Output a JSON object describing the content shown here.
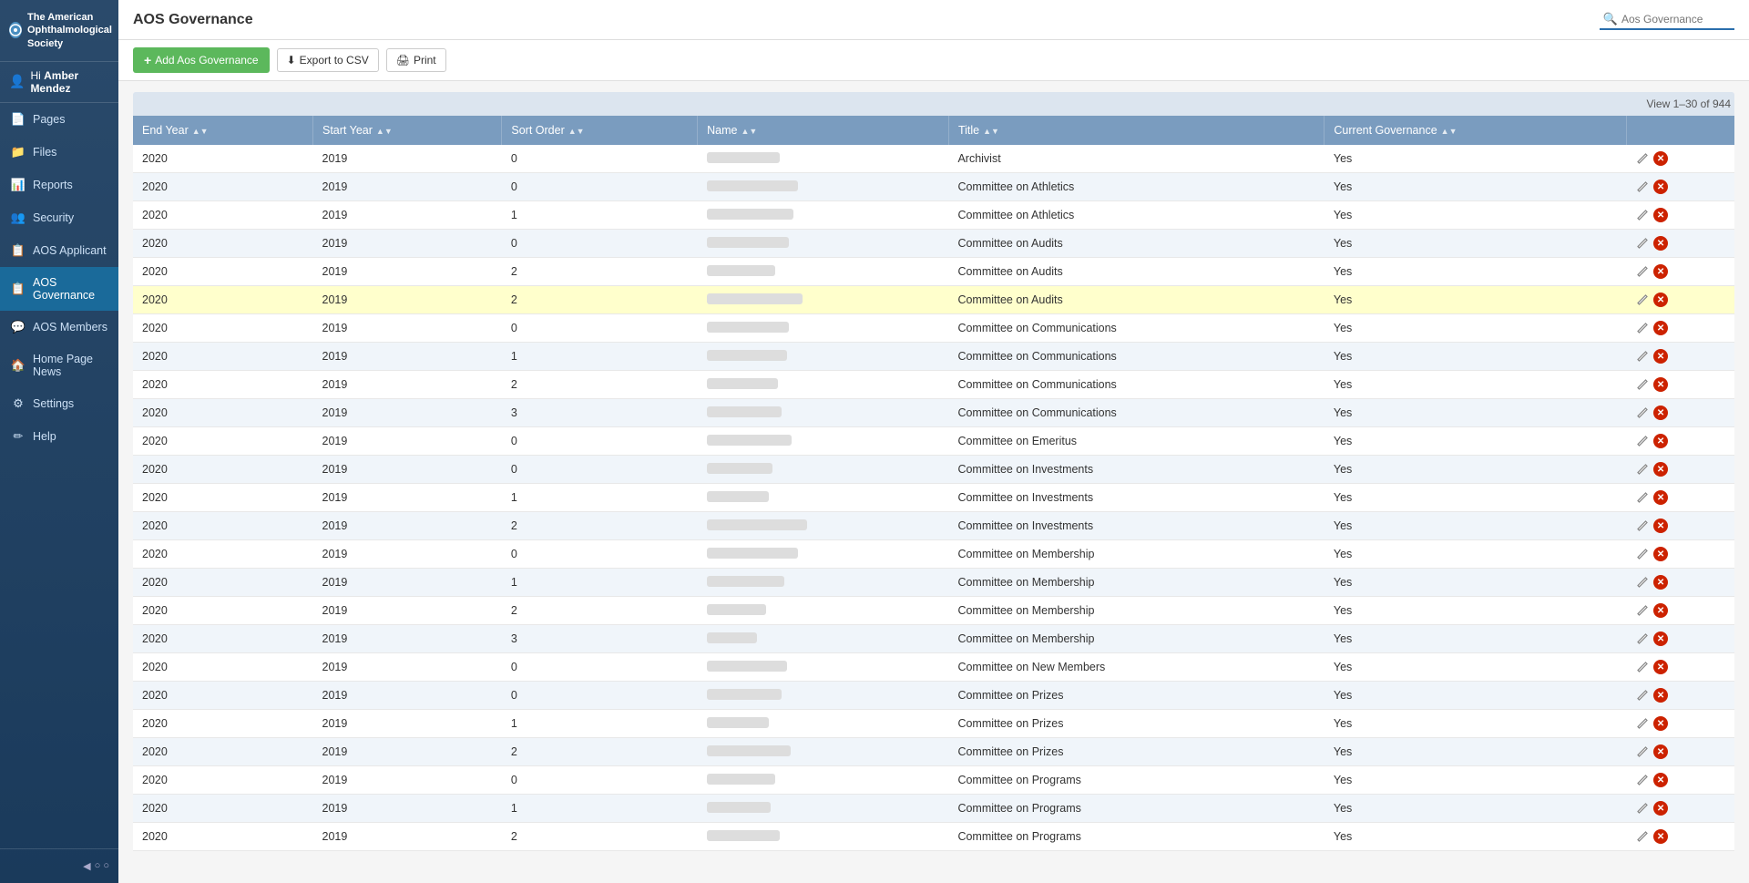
{
  "sidebar": {
    "logo_line1": "The American",
    "logo_line2": "Ophthalmological",
    "logo_line3": "Society",
    "user_greeting": "Hi",
    "user_name": "Amber Mendez",
    "items": [
      {
        "id": "pages",
        "label": "Pages",
        "icon": "📄",
        "active": false
      },
      {
        "id": "files",
        "label": "Files",
        "icon": "📁",
        "active": false
      },
      {
        "id": "reports",
        "label": "Reports",
        "icon": "📊",
        "active": false
      },
      {
        "id": "security",
        "label": "Security",
        "icon": "👥",
        "active": false
      },
      {
        "id": "aos-applicant",
        "label": "AOS Applicant",
        "icon": "📋",
        "active": false
      },
      {
        "id": "aos-governance",
        "label": "AOS Governance",
        "icon": "📋",
        "active": true
      },
      {
        "id": "aos-members",
        "label": "AOS Members",
        "icon": "💬",
        "active": false
      },
      {
        "id": "home-page-news",
        "label": "Home Page News",
        "icon": "🏠",
        "active": false
      },
      {
        "id": "settings",
        "label": "Settings",
        "icon": "⚙",
        "active": false
      },
      {
        "id": "help",
        "label": "Help",
        "icon": "✏",
        "active": false
      }
    ]
  },
  "topbar": {
    "title": "AOS Governance",
    "search_placeholder": "Aos Governance"
  },
  "action_bar": {
    "add_label": "Add Aos Governance",
    "export_label": "Export to CSV",
    "print_label": "Print"
  },
  "table": {
    "pagination": "View 1–30 of 944",
    "columns": [
      "End Year",
      "Start Year",
      "Sort Order",
      "Name",
      "Title",
      "Current Governance",
      ""
    ],
    "rows": [
      {
        "end_year": "2020",
        "start_year": "2019",
        "sort_order": "0",
        "name_width": "80",
        "title": "Archivist",
        "current": "Yes",
        "highlighted": false
      },
      {
        "end_year": "2020",
        "start_year": "2019",
        "sort_order": "0",
        "name_width": "100",
        "title": "Committee on Athletics",
        "current": "Yes",
        "highlighted": false
      },
      {
        "end_year": "2020",
        "start_year": "2019",
        "sort_order": "1",
        "name_width": "95",
        "title": "Committee on Athletics",
        "current": "Yes",
        "highlighted": false
      },
      {
        "end_year": "2020",
        "start_year": "2019",
        "sort_order": "0",
        "name_width": "90",
        "title": "Committee on Audits",
        "current": "Yes",
        "highlighted": false
      },
      {
        "end_year": "2020",
        "start_year": "2019",
        "sort_order": "2",
        "name_width": "75",
        "title": "Committee on Audits",
        "current": "Yes",
        "highlighted": false
      },
      {
        "end_year": "2020",
        "start_year": "2019",
        "sort_order": "2",
        "name_width": "105",
        "title": "Committee on Audits",
        "current": "Yes",
        "highlighted": true
      },
      {
        "end_year": "2020",
        "start_year": "2019",
        "sort_order": "0",
        "name_width": "90",
        "title": "Committee on Communications",
        "current": "Yes",
        "highlighted": false
      },
      {
        "end_year": "2020",
        "start_year": "2019",
        "sort_order": "1",
        "name_width": "88",
        "title": "Committee on Communications",
        "current": "Yes",
        "highlighted": false
      },
      {
        "end_year": "2020",
        "start_year": "2019",
        "sort_order": "2",
        "name_width": "78",
        "title": "Committee on Communications",
        "current": "Yes",
        "highlighted": false
      },
      {
        "end_year": "2020",
        "start_year": "2019",
        "sort_order": "3",
        "name_width": "82",
        "title": "Committee on Communications",
        "current": "Yes",
        "highlighted": false
      },
      {
        "end_year": "2020",
        "start_year": "2019",
        "sort_order": "0",
        "name_width": "93",
        "title": "Committee on Emeritus",
        "current": "Yes",
        "highlighted": false
      },
      {
        "end_year": "2020",
        "start_year": "2019",
        "sort_order": "0",
        "name_width": "72",
        "title": "Committee on Investments",
        "current": "Yes",
        "highlighted": false
      },
      {
        "end_year": "2020",
        "start_year": "2019",
        "sort_order": "1",
        "name_width": "68",
        "title": "Committee on Investments",
        "current": "Yes",
        "highlighted": false
      },
      {
        "end_year": "2020",
        "start_year": "2019",
        "sort_order": "2",
        "name_width": "110",
        "title": "Committee on Investments",
        "current": "Yes",
        "highlighted": false
      },
      {
        "end_year": "2020",
        "start_year": "2019",
        "sort_order": "0",
        "name_width": "100",
        "title": "Committee on Membership",
        "current": "Yes",
        "highlighted": false
      },
      {
        "end_year": "2020",
        "start_year": "2019",
        "sort_order": "1",
        "name_width": "85",
        "title": "Committee on Membership",
        "current": "Yes",
        "highlighted": false
      },
      {
        "end_year": "2020",
        "start_year": "2019",
        "sort_order": "2",
        "name_width": "65",
        "title": "Committee on Membership",
        "current": "Yes",
        "highlighted": false
      },
      {
        "end_year": "2020",
        "start_year": "2019",
        "sort_order": "3",
        "name_width": "55",
        "title": "Committee on Membership",
        "current": "Yes",
        "highlighted": false
      },
      {
        "end_year": "2020",
        "start_year": "2019",
        "sort_order": "0",
        "name_width": "88",
        "title": "Committee on New Members",
        "current": "Yes",
        "highlighted": false
      },
      {
        "end_year": "2020",
        "start_year": "2019",
        "sort_order": "0",
        "name_width": "82",
        "title": "Committee on Prizes",
        "current": "Yes",
        "highlighted": false
      },
      {
        "end_year": "2020",
        "start_year": "2019",
        "sort_order": "1",
        "name_width": "68",
        "title": "Committee on Prizes",
        "current": "Yes",
        "highlighted": false
      },
      {
        "end_year": "2020",
        "start_year": "2019",
        "sort_order": "2",
        "name_width": "92",
        "title": "Committee on Prizes",
        "current": "Yes",
        "highlighted": false
      },
      {
        "end_year": "2020",
        "start_year": "2019",
        "sort_order": "0",
        "name_width": "75",
        "title": "Committee on Programs",
        "current": "Yes",
        "highlighted": false
      },
      {
        "end_year": "2020",
        "start_year": "2019",
        "sort_order": "1",
        "name_width": "70",
        "title": "Committee on Programs",
        "current": "Yes",
        "highlighted": false
      },
      {
        "end_year": "2020",
        "start_year": "2019",
        "sort_order": "2",
        "name_width": "80",
        "title": "Committee on Programs",
        "current": "Yes",
        "highlighted": false
      }
    ]
  },
  "icons": {
    "search": "🔍",
    "add": "+",
    "export": "⬇",
    "print": "🖨",
    "edit": "✏",
    "delete": "✕",
    "user": "👤",
    "collapse": "◀"
  }
}
